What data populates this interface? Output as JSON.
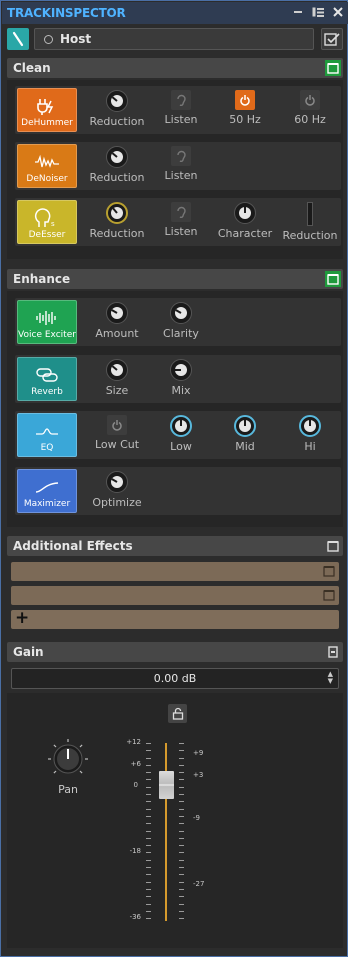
{
  "window": {
    "title": "TRACKINSPECTOR"
  },
  "track": {
    "name": "Host"
  },
  "sections": {
    "clean": {
      "label": "Clean"
    },
    "enhance": {
      "label": "Enhance"
    },
    "additional": {
      "label": "Additional Effects"
    },
    "gain": {
      "label": "Gain"
    }
  },
  "clean": {
    "dehummer": {
      "label": "DeHummer",
      "color": "#e06a1a",
      "reduction": "Reduction",
      "listen": "Listen",
      "hz50": "50 Hz",
      "hz60": "60 Hz"
    },
    "denoiser": {
      "label": "DeNoiser",
      "color": "#d97a16",
      "reduction": "Reduction",
      "listen": "Listen"
    },
    "deesser": {
      "label": "DeEsser",
      "color": "#c9b62a",
      "reduction": "Reduction",
      "listen": "Listen",
      "character": "Character",
      "reduction2": "Reduction"
    }
  },
  "enhance": {
    "voice_exciter": {
      "label": "Voice Exciter",
      "color": "#1fa352",
      "amount": "Amount",
      "clarity": "Clarity"
    },
    "reverb": {
      "label": "Reverb",
      "color": "#1f8f8a",
      "size": "Size",
      "mix": "Mix"
    },
    "eq": {
      "label": "EQ",
      "color": "#3aa7d8",
      "low_cut": "Low Cut",
      "low": "Low",
      "mid": "Mid",
      "hi": "Hi"
    },
    "maximizer": {
      "label": "Maximizer",
      "color": "#3f6fd0",
      "optimize": "Optimize"
    }
  },
  "gain": {
    "value": "0.00 dB",
    "pan_label": "Pan",
    "scale_left": [
      "+12",
      "+6",
      "0",
      "-18",
      "-36"
    ],
    "scale_right": [
      "+9",
      "+3",
      "-9",
      "-27"
    ]
  }
}
